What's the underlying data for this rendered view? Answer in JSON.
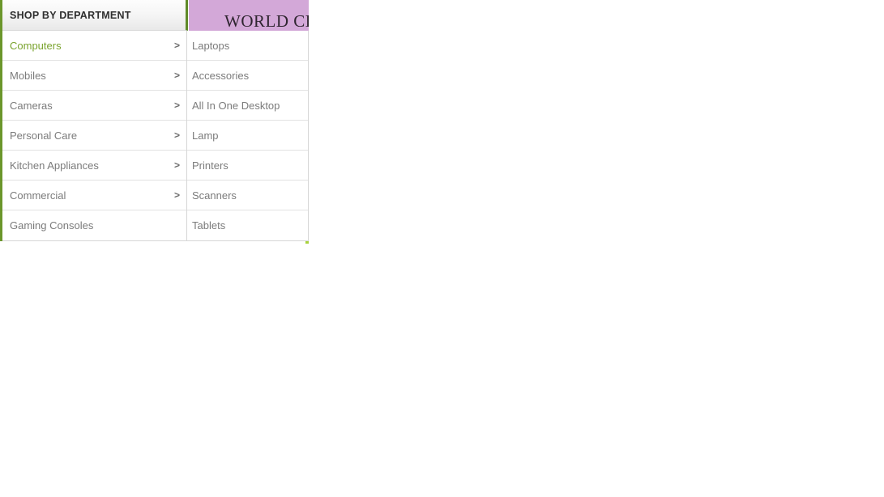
{
  "backdrop": {
    "promo_banner": {
      "text": "WORLD CLA",
      "background_color": "#d3a8d8"
    }
  },
  "department_menu": {
    "header": {
      "title": "SHOP BY DEPARTMENT"
    },
    "accent_color": "#6b962b",
    "active_item_color": "#7aa32e",
    "item_color": "#7b7b7b",
    "arrow_glyph": ">",
    "items": [
      {
        "label": "Computers",
        "has_arrow": true,
        "active": true
      },
      {
        "label": "Mobiles",
        "has_arrow": true,
        "active": false
      },
      {
        "label": "Cameras",
        "has_arrow": true,
        "active": false
      },
      {
        "label": "Personal Care",
        "has_arrow": true,
        "active": false
      },
      {
        "label": "Kitchen Appliances",
        "has_arrow": true,
        "active": false
      },
      {
        "label": "Commercial",
        "has_arrow": true,
        "active": false
      },
      {
        "label": "Gaming Consoles",
        "has_arrow": false,
        "active": false
      }
    ]
  },
  "submenu": {
    "parent": "Computers",
    "items": [
      {
        "label": "Laptops"
      },
      {
        "label": "Accessories"
      },
      {
        "label": "All In One Desktop"
      },
      {
        "label": "Lamp"
      },
      {
        "label": "Printers"
      },
      {
        "label": "Scanners"
      },
      {
        "label": "Tablets"
      }
    ]
  }
}
